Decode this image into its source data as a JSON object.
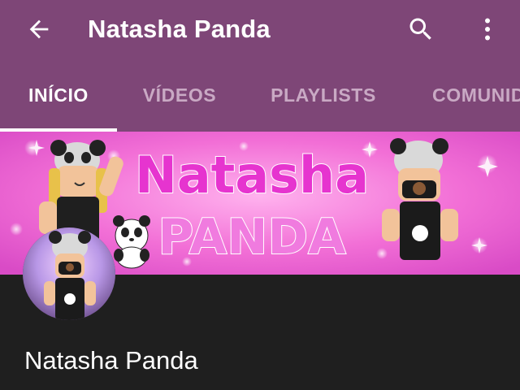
{
  "app_bar": {
    "title": "Natasha Panda",
    "back_icon": "arrow-back-icon",
    "search_icon": "search-icon",
    "more_icon": "more-vert-icon",
    "background_color": "#7e4677"
  },
  "tabs": [
    {
      "label": "INÍCIO",
      "active": true
    },
    {
      "label": "VÍDEOS",
      "active": false
    },
    {
      "label": "PLAYLISTS",
      "active": false
    },
    {
      "label": "COMUNID",
      "active": false
    }
  ],
  "banner": {
    "line1": "Natasha",
    "line2": "PANDA",
    "background_color": "#f06ad0",
    "text_color": "#e33ad0"
  },
  "channel": {
    "name": "Natasha Panda"
  }
}
